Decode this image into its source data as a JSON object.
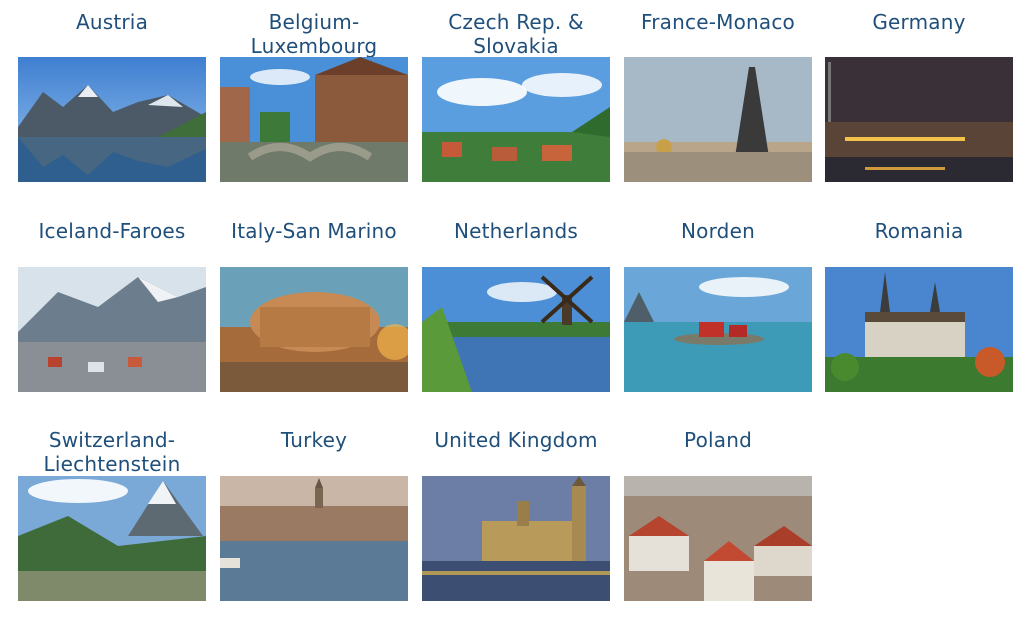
{
  "destinations": [
    {
      "name": "Austria",
      "image_icon": "austria-alpine-lake-photo"
    },
    {
      "name": "Belgium-\nLuxembourg",
      "image_icon": "belgium-bridge-photo"
    },
    {
      "name": "Czech Rep. &\nSlovakia",
      "image_icon": "czech-city-photo"
    },
    {
      "name": "France-Monaco",
      "image_icon": "eiffel-tower-photo"
    },
    {
      "name": "Germany",
      "image_icon": "germany-night-city-photo"
    },
    {
      "name": "Iceland-Faroes",
      "image_icon": "iceland-town-photo"
    },
    {
      "name": "Italy-San Marino",
      "image_icon": "colosseum-photo"
    },
    {
      "name": "Netherlands",
      "image_icon": "windmill-photo"
    },
    {
      "name": "Norden",
      "image_icon": "nordic-red-houses-photo"
    },
    {
      "name": "Romania",
      "image_icon": "peles-castle-photo"
    },
    {
      "name": "Switzerland-\nLiechtenstein",
      "image_icon": "matterhorn-photo"
    },
    {
      "name": "Turkey",
      "image_icon": "istanbul-skyline-photo"
    },
    {
      "name": "United Kingdom",
      "image_icon": "big-ben-photo"
    },
    {
      "name": "Poland",
      "image_icon": "polish-old-town-photo"
    }
  ],
  "colors": {
    "title_text": "#1f4f7a",
    "background": "#ffffff"
  }
}
